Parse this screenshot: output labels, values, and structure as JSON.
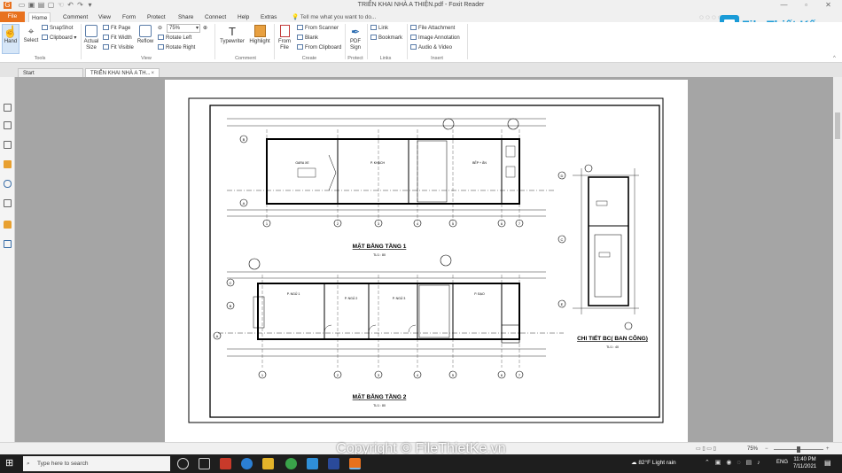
{
  "window": {
    "title": "TRIỂN KHAI NHÀ A THIỆN.pdf - Foxit Reader"
  },
  "ribbon_tabs": [
    "File",
    "Home",
    "Comment",
    "View",
    "Form",
    "Protect",
    "Share",
    "Connect",
    "Help",
    "Extras"
  ],
  "tell_me": "Tell me what you want to do...",
  "ribbon": {
    "hand": "Hand",
    "select": "Select",
    "snapshot": "SnapShot",
    "clipboard": "Clipboard",
    "actual_size": "Actual Size",
    "fit_page": "Fit Page",
    "fit_width": "Fit Width",
    "fit_visible": "Fit Visible",
    "reflow": "Reflow",
    "zoom_value": "75%",
    "rotate_left": "Rotate Left",
    "rotate_right": "Rotate Right",
    "typewriter": "Typewriter",
    "highlight": "Highlight",
    "from_file": "From File",
    "from_scanner": "From Scanner",
    "blank": "Blank",
    "from_clipboard": "From Clipboard",
    "pdf_sign": "PDF Sign",
    "link": "Link",
    "bookmark": "Bookmark",
    "file_attachment": "File Attachment",
    "image_annotation": "Image Annotation",
    "audio_video": "Audio & Video",
    "groups": {
      "tools": "Tools",
      "view": "View",
      "comment": "Comment",
      "create": "Create",
      "protect": "Protect",
      "links": "Links",
      "insert": "Insert"
    }
  },
  "logo_text": "File Thiết Kế.vn",
  "doc_tabs": [
    "Start",
    "TRIỂN KHAI NHÀ A TH..."
  ],
  "drawing": {
    "plan1_title": "MẶT BẰNG TẦNG 1",
    "plan1_scale": "TL/1 : 80",
    "plan2_title": "MẶT BẰNG TẦNG 2",
    "plan2_scale": "TL/1 : 80",
    "detail_title": "CHI TIẾT BC( BAN CÔNG)",
    "detail_scale": "TL/1 : 40",
    "room1": "GARA XE",
    "room2": "P. KHÁCH",
    "room3": "BẾP + ĂN",
    "room4": "P. NGỦ 1",
    "room5": "P. NGỦ 2",
    "room6": "P. NGỦ 3",
    "room7": "P. ĐẠO",
    "grid_a": "A",
    "grid_b": "B",
    "grid_c": "C",
    "grid_d": "D",
    "grid_e": "E",
    "axes": [
      "1",
      "2",
      "3",
      "4",
      "5",
      "6",
      "7"
    ]
  },
  "status": {
    "zoom": "75%"
  },
  "watermark": "Copyright © FileThietKe.vn",
  "taskbar": {
    "search_placeholder": "Type here to search",
    "weather": "82°F  Light rain",
    "lang": "ENG",
    "time": "11:40 PM",
    "date": "7/11/2021"
  }
}
